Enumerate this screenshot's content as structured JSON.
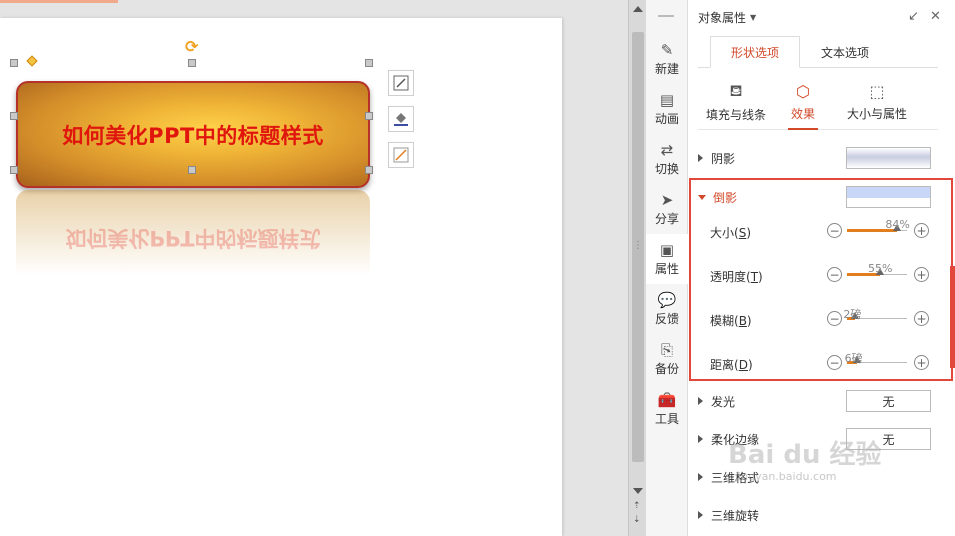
{
  "slide": {
    "title_text": "如何美化PPT中的标题样式"
  },
  "float_tools": [
    "shape-outline",
    "fill-bucket",
    "line-style"
  ],
  "rail": {
    "items": [
      {
        "label": "新建",
        "icon": "✎"
      },
      {
        "label": "动画",
        "icon": "▤"
      },
      {
        "label": "切换",
        "icon": "⇄"
      },
      {
        "label": "分享",
        "icon": "➤"
      },
      {
        "label": "属性",
        "icon": "▣"
      },
      {
        "label": "反馈",
        "icon": "💬"
      },
      {
        "label": "备份",
        "icon": "⎘"
      },
      {
        "label": "工具",
        "icon": "🧰"
      }
    ],
    "active_index": 4
  },
  "pane": {
    "title": "对象属性",
    "tabs": [
      "形状选项",
      "文本选项"
    ],
    "active_tab": 0,
    "subtabs": [
      "填充与线条",
      "效果",
      "大小与属性"
    ],
    "active_subtab": 1
  },
  "effects": {
    "shadow_label": "阴影",
    "reflection_label": "倒影",
    "glow_label": "发光",
    "glow_value": "无",
    "soft_edge_label": "柔化边缘",
    "soft_edge_value": "无",
    "format3d_label": "三维格式",
    "rotate3d_label": "三维旋转"
  },
  "reflection_sliders": [
    {
      "label_pre": "大小(",
      "key": "S",
      "label_post": ")",
      "value": "84%",
      "fraction": 0.84
    },
    {
      "label_pre": "透明度(",
      "key": "T",
      "label_post": ")",
      "value": "55%",
      "fraction": 0.55
    },
    {
      "label_pre": "模糊(",
      "key": "B",
      "label_post": ")",
      "value": "2磅",
      "fraction": 0.14
    },
    {
      "label_pre": "距离(",
      "key": "D",
      "label_post": ")",
      "value": "6磅",
      "fraction": 0.16
    }
  ],
  "colors": {
    "accent": "#d24a2a",
    "highlight": "#e2473b",
    "title_red": "#e0150d",
    "slider_fill": "#e27e1e"
  },
  "watermark": {
    "text": "Bai du 经验",
    "sub": "jingyan.baidu.com"
  }
}
